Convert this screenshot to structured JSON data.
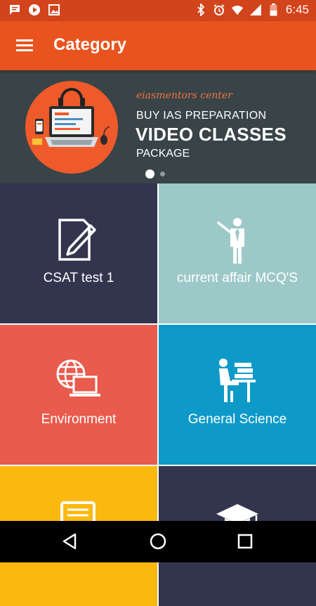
{
  "status_bar": {
    "time": "6:45",
    "icons": [
      "message-icon",
      "play-icon",
      "image-icon",
      "bluetooth-icon",
      "alarm-icon",
      "wifi-icon",
      "signal-icon",
      "battery-icon"
    ]
  },
  "app_bar": {
    "title": "Category",
    "menu_icon": "menu-icon"
  },
  "banner": {
    "brand": "eiasmentors center",
    "line1": "BUY IAS PREPARATION",
    "line2": "VIDEO CLASSES",
    "line3": "PACKAGE",
    "slides": 2,
    "active_slide": 1
  },
  "categories": [
    {
      "label": "CSAT test 1",
      "icon": "document-pen-icon",
      "color": "#33354f"
    },
    {
      "label": "current affair MCQ'S",
      "icon": "teacher-icon",
      "color": "#9dc8c8"
    },
    {
      "label": "Environment",
      "icon": "globe-laptop-icon",
      "color": "#e85b4d"
    },
    {
      "label": "General Science",
      "icon": "student-desk-icon",
      "color": "#0d9ac9"
    },
    {
      "label": "",
      "icon": "document-icon",
      "color": "#fbb910"
    },
    {
      "label": "",
      "icon": "graduation-cap-icon",
      "color": "#33354f"
    }
  ],
  "colors": {
    "status_bar": "#d2441b",
    "app_bar": "#e8531e",
    "banner_bg": "#384447",
    "banner_accent": "#ef5a2b"
  },
  "nav_bar": {
    "buttons": [
      "back-icon",
      "home-icon",
      "recents-icon"
    ]
  }
}
